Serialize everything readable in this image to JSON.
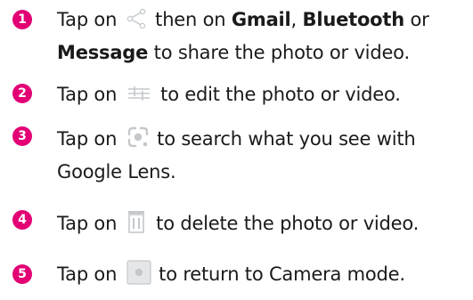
{
  "steps": [
    {
      "number": "1",
      "icon": "share-icon",
      "text_a": "Tap on",
      "text_b": "then on",
      "app_1": "Gmail",
      "sep_1": ",",
      "app_2": "Bluetooth",
      "text_c": "or",
      "app_3": "Message",
      "text_d": "to share the photo or video."
    },
    {
      "number": "2",
      "icon": "edit-sliders-icon",
      "text_a": "Tap on",
      "text_b": "to edit the photo or video."
    },
    {
      "number": "3",
      "icon": "google-lens-icon",
      "text_a": "Tap on",
      "text_b": "to search what you see with",
      "text_c": "Google Lens."
    },
    {
      "number": "4",
      "icon": "trash-icon",
      "text_a": "Tap on",
      "text_b": "to delete the photo or video."
    },
    {
      "number": "5",
      "icon": "camera-icon",
      "text_a": "Tap on",
      "text_b": "to return to Camera mode."
    }
  ],
  "colors": {
    "accent": "#e20074",
    "text": "#1a1a1a",
    "icon": "#bfc3c6"
  }
}
